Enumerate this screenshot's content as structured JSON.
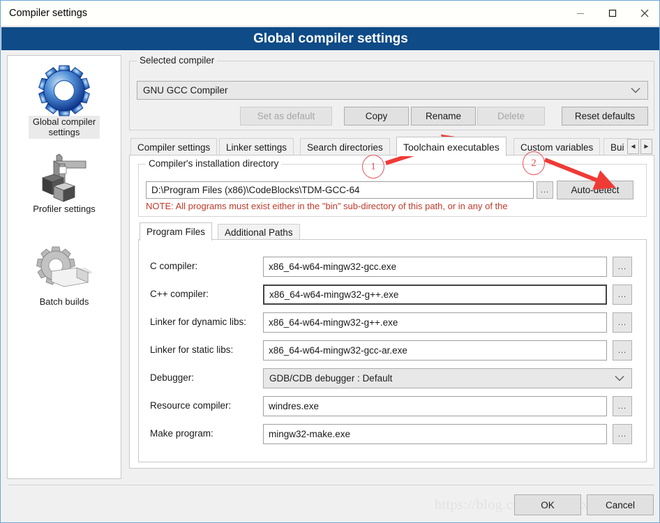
{
  "window": {
    "title": "Compiler settings",
    "minimize_label": "minimize",
    "maximize_label": "maximize",
    "close_label": "close"
  },
  "banner": {
    "title": "Global compiler settings"
  },
  "sidebar": {
    "items": [
      {
        "label": "Global compiler\nsettings",
        "label_line1": "Global compiler",
        "label_line2": "settings",
        "icon": "blue-gear-icon",
        "selected": true
      },
      {
        "label": "Profiler settings",
        "icon": "caliper-cubes-icon",
        "selected": false
      },
      {
        "label": "Batch builds",
        "icon": "gear-stack-icon",
        "selected": false
      }
    ]
  },
  "selected_compiler_group": {
    "title": "Selected compiler",
    "combo_value": "GNU GCC Compiler",
    "buttons": [
      {
        "label": "Set as default",
        "enabled": false
      },
      {
        "label": "Copy",
        "enabled": true
      },
      {
        "label": "Rename",
        "enabled": true
      },
      {
        "label": "Delete",
        "enabled": false
      },
      {
        "label": "Reset defaults",
        "enabled": true
      }
    ]
  },
  "tabs": {
    "items": [
      {
        "label": "Compiler settings",
        "active": false
      },
      {
        "label": "Linker settings",
        "active": false
      },
      {
        "label": "Search directories",
        "active": false
      },
      {
        "label": "Toolchain executables",
        "active": true
      },
      {
        "label": "Custom variables",
        "active": false
      },
      {
        "label": "Bui",
        "active": false
      }
    ],
    "scroll_left": "◄",
    "scroll_right": "►"
  },
  "install_dir_group": {
    "title": "Compiler's installation directory",
    "path_value": "D:\\Program Files (x86)\\CodeBlocks\\TDM-GCC-64",
    "browse_label": "...",
    "auto_detect_label": "Auto-detect",
    "note": "NOTE: All programs must exist either in the \"bin\" sub-directory of this path, or in any of the"
  },
  "inner_tabs": {
    "items": [
      {
        "label": "Program Files",
        "active": true
      },
      {
        "label": "Additional Paths",
        "active": false
      }
    ]
  },
  "program_files": {
    "browse_label": "...",
    "fields": [
      {
        "label": "C compiler:",
        "value": "x86_64-w64-mingw32-gcc.exe",
        "type": "text",
        "focused": false
      },
      {
        "label": "C++ compiler:",
        "value": "x86_64-w64-mingw32-g++.exe",
        "type": "text",
        "focused": true
      },
      {
        "label": "Linker for dynamic libs:",
        "value": "x86_64-w64-mingw32-g++.exe",
        "type": "text",
        "focused": false
      },
      {
        "label": "Linker for static libs:",
        "value": "x86_64-w64-mingw32-gcc-ar.exe",
        "type": "text",
        "focused": false
      },
      {
        "label": "Debugger:",
        "value": "GDB/CDB debugger : Default",
        "type": "combo",
        "focused": false
      },
      {
        "label": "Resource compiler:",
        "value": "windres.exe",
        "type": "text",
        "focused": false
      },
      {
        "label": "Make program:",
        "value": "mingw32-make.exe",
        "type": "text",
        "focused": false
      }
    ]
  },
  "footer": {
    "ok_label": "OK",
    "cancel_label": "Cancel",
    "watermark": "https://blog.csdn.net/xxxxxxxxx"
  },
  "annotations": [
    {
      "number": "1",
      "target": "Toolchain executables tab"
    },
    {
      "number": "2",
      "target": "Auto-detect button"
    }
  ],
  "colors": {
    "banner_blue": "#0e4b87",
    "note_red": "#c0392b",
    "annotation_red": "#e8505b",
    "window_border": "#6ca6d9"
  }
}
